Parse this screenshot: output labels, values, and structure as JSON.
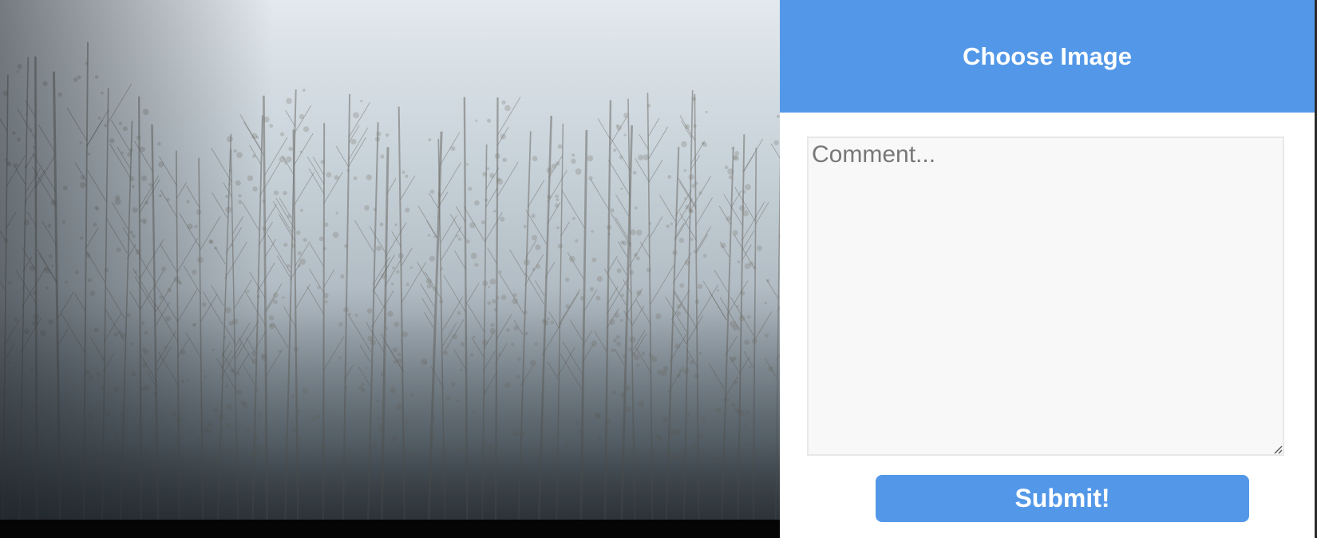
{
  "photo": {
    "subject": "foggy-forest-photo"
  },
  "form": {
    "choose_image_label": "Choose Image",
    "comment_placeholder": "Comment...",
    "comment_value": "",
    "submit_label": "Submit!"
  },
  "colors": {
    "accent": "#5398e8",
    "panel_bg": "#ffffff",
    "textarea_bg": "#f8f8f8"
  }
}
